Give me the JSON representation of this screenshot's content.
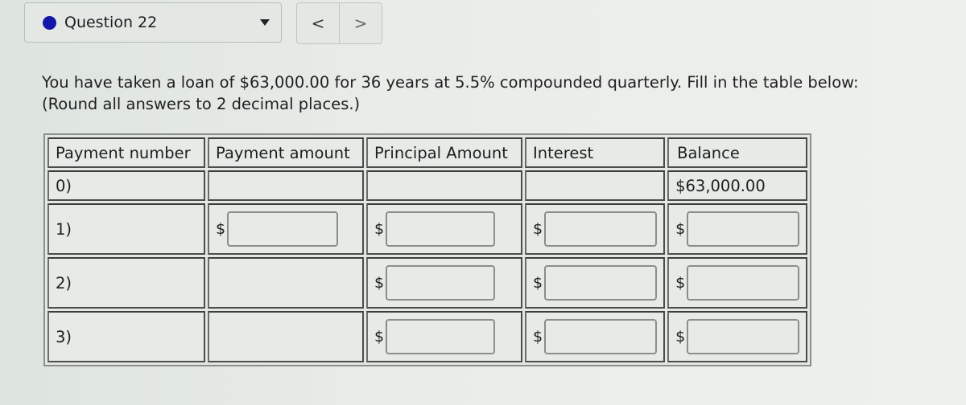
{
  "header": {
    "question_label": "Question 22",
    "status_color": "#1416a8",
    "prev_label": "<",
    "next_label": ">"
  },
  "prompt": {
    "line1": "You have taken a loan of $63,000.00 for 36 years at 5.5% compounded quarterly. Fill in the table below:",
    "line2": "(Round all answers to 2 decimal places.)"
  },
  "table": {
    "columns": [
      "Payment number",
      "Payment amount",
      "Principal Amount",
      "Interest",
      "Balance"
    ],
    "currency_symbol": "$",
    "rows": [
      {
        "number": "0)",
        "balance": "$63,000.00"
      },
      {
        "number": "1)",
        "payment": "",
        "principal": "",
        "interest": "",
        "balance": ""
      },
      {
        "number": "2)",
        "principal": "",
        "interest": "",
        "balance": ""
      },
      {
        "number": "3)",
        "principal": "",
        "interest": "",
        "balance": ""
      }
    ]
  }
}
